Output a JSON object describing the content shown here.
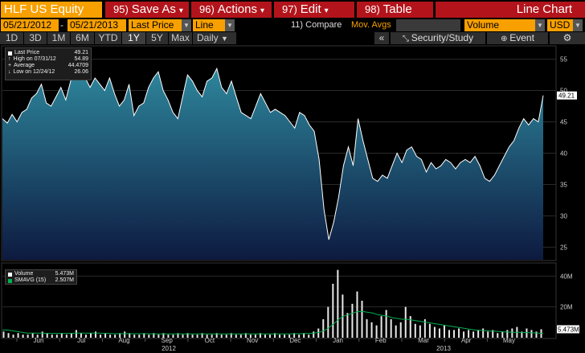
{
  "header": {
    "security": "HLF US Equity",
    "buttons": [
      {
        "num": "95)",
        "label": "Save As",
        "arrow": "▾"
      },
      {
        "num": "96)",
        "label": "Actions",
        "arrow": "▾"
      },
      {
        "num": "97)",
        "label": "Edit",
        "arrow": "▾"
      },
      {
        "num": "98)",
        "label": "Table",
        "arrow": ""
      }
    ],
    "chart_title": "Line Chart"
  },
  "range": {
    "start_date": "05/21/2012",
    "end_date": "05/21/2013",
    "field": "Last Price",
    "style": "Line",
    "compare": "11) Compare",
    "mov_avgs": "Mov. Avgs",
    "lower": "Volume",
    "currency": "USD"
  },
  "periods": [
    "1D",
    "3D",
    "1M",
    "6M",
    "YTD",
    "1Y",
    "5Y",
    "Max"
  ],
  "active_period": "1Y",
  "frequency": "Daily",
  "toolbar": {
    "collapse": "«",
    "security_study": "Security/Study",
    "event": "Event",
    "settings": "⚙"
  },
  "price_legend": {
    "last_price_label": "Last Price",
    "last_price_value": "49.21",
    "high_label": "High on 07/31/12",
    "high_value": "54.89",
    "average_label": "Average",
    "average_value": "44.4709",
    "low_label": "Low on 12/24/12",
    "low_value": "26.06"
  },
  "volume_legend": {
    "volume_label": "Volume",
    "volume_value": "5.473M",
    "smavg_label": "SMAVG (15)",
    "smavg_value": "2.507M"
  },
  "colors": {
    "orange": "#f7a000",
    "red": "#b3141b",
    "area_top": "#2f8ba0",
    "area_bottom": "#0d1a40",
    "smavg": "#00b050"
  },
  "chart_data": {
    "type": "area",
    "series_name": "Last Price",
    "ylim": [
      23,
      57
    ],
    "yticks": [
      25,
      30,
      35,
      40,
      45,
      50,
      55
    ],
    "last_value_tag": "49.21",
    "x_months": [
      "Jun",
      "Jul",
      "Aug",
      "Sep",
      "Oct",
      "Nov",
      "Dec",
      "Jan",
      "Feb",
      "Mar",
      "Apr",
      "May"
    ],
    "x_years": [
      "2012",
      "2013"
    ],
    "price": [
      45.5,
      44.8,
      46.2,
      45.0,
      46.5,
      47.0,
      48.8,
      49.5,
      51.0,
      48.0,
      47.5,
      49.0,
      50.5,
      48.5,
      51.5,
      54.8,
      53.0,
      52.0,
      50.5,
      52.0,
      51.0,
      50.0,
      52.0,
      49.5,
      47.5,
      48.5,
      51.0,
      46.0,
      47.5,
      48.0,
      50.5,
      52.0,
      53.0,
      50.0,
      48.5,
      46.5,
      45.5,
      49.0,
      52.5,
      51.5,
      50.0,
      49.0,
      51.5,
      52.0,
      53.5,
      50.5,
      49.5,
      51.5,
      49.0,
      46.5,
      46.0,
      45.5,
      47.5,
      49.5,
      48.0,
      46.5,
      47.0,
      46.5,
      46.0,
      45.0,
      44.0,
      46.5,
      46.0,
      44.5,
      43.5,
      39.0,
      31.0,
      26.2,
      29.0,
      33.0,
      38.0,
      41.0,
      38.0,
      45.5,
      42.0,
      39.0,
      36.0,
      35.5,
      36.5,
      36.0,
      38.0,
      40.0,
      38.5,
      40.5,
      41.0,
      39.5,
      39.0,
      37.0,
      38.5,
      37.5,
      38.0,
      39.0,
      38.5,
      37.5,
      38.5,
      39.0,
      38.5,
      39.5,
      38.0,
      36.0,
      35.5,
      36.5,
      38.0,
      39.5,
      41.0,
      42.0,
      44.0,
      45.5,
      44.5,
      45.5,
      45.0,
      49.21
    ],
    "volume_ylim": [
      0,
      48
    ],
    "volume_yticks": [
      {
        "value": 20,
        "label": "20M"
      },
      {
        "value": 40,
        "label": "40M"
      }
    ],
    "volume_last_tag": "5.473M",
    "volume": [
      4,
      3,
      2,
      3,
      2,
      2,
      3,
      2,
      4,
      3,
      2,
      2,
      3,
      2,
      3,
      5,
      3,
      2,
      3,
      4,
      2,
      3,
      2,
      2,
      3,
      4,
      3,
      2,
      2,
      3,
      2,
      3,
      2,
      3,
      2,
      2,
      3,
      2,
      3,
      2,
      2,
      3,
      2,
      2,
      3,
      2,
      2,
      3,
      2,
      2,
      3,
      2,
      2,
      3,
      2,
      2,
      3,
      2,
      2,
      2,
      3,
      2,
      3,
      2,
      4,
      6,
      12,
      20,
      35,
      44,
      28,
      16,
      22,
      30,
      24,
      12,
      10,
      8,
      14,
      18,
      12,
      8,
      10,
      20,
      14,
      9,
      8,
      12,
      9,
      7,
      6,
      8,
      5,
      5,
      6,
      4,
      5,
      4,
      5,
      6,
      4,
      5,
      3,
      4,
      5,
      6,
      7,
      4,
      6,
      5,
      4,
      5.5
    ],
    "smavg": [
      5,
      5,
      4.5,
      4,
      3.5,
      3,
      3,
      3,
      3,
      2.8,
      2.8,
      2.8,
      2.8,
      2.8,
      2.8,
      3,
      3,
      3,
      3,
      3,
      3,
      2.8,
      2.8,
      2.6,
      2.6,
      2.6,
      2.6,
      2.6,
      2.6,
      2.6,
      2.6,
      2.5,
      2.5,
      2.5,
      2.5,
      2.5,
      2.5,
      2.5,
      2.5,
      2.5,
      2.5,
      2.5,
      2.5,
      2.5,
      2.5,
      2.5,
      2.5,
      2.5,
      2.5,
      2.5,
      2.5,
      2.5,
      2.5,
      2.5,
      2.5,
      2.5,
      2.5,
      2.5,
      2.5,
      2.5,
      2.6,
      2.6,
      2.7,
      2.8,
      3,
      3.5,
      4.5,
      6.5,
      9,
      12,
      14,
      15,
      16,
      17,
      17,
      16.5,
      16,
      15,
      14.5,
      14,
      13,
      12.5,
      12,
      12,
      11.5,
      11,
      10.5,
      10,
      9.5,
      9,
      8.5,
      8,
      7.5,
      7,
      6.5,
      6,
      5.5,
      5,
      4.8,
      4.6,
      4.4,
      4.2,
      4,
      3.8,
      3.6,
      3.5,
      3.5,
      3.4,
      3.3,
      3.2,
      3,
      2.8
    ]
  }
}
